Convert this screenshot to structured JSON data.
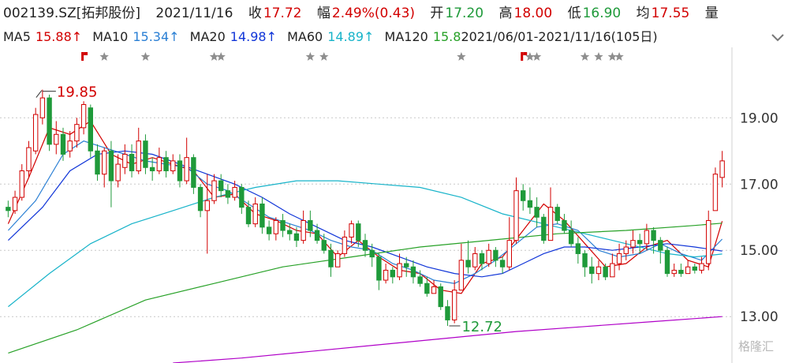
{
  "header": {
    "symbol": "002139.SZ[拓邦股份]",
    "date": "2021/11/16",
    "close_label": "收",
    "close_value": "17.72",
    "change_label": "幅",
    "change_value": "2.49%(0.43)",
    "open_label": "开",
    "open_value": "17.20",
    "high_label": "高",
    "high_value": "18.00",
    "low_label": "低",
    "low_value": "16.90",
    "avg_label": "均",
    "avg_value": "17.55",
    "volume_label": "量"
  },
  "ma_bar": {
    "items": [
      {
        "label": "MA5",
        "value": "15.88↑",
        "color": "#d20000"
      },
      {
        "label": "MA10",
        "value": "15.34↑",
        "color": "#2a7fd4"
      },
      {
        "label": "MA20",
        "value": "14.98↑",
        "color": "#1035d8"
      },
      {
        "label": "MA60",
        "value": "14.89↑",
        "color": "#17b3c9"
      },
      {
        "label": "MA120",
        "value": "15.8",
        "color": "#27a127"
      }
    ],
    "overlap_text": "2021/06/01-2021/11/16(105日)",
    "dropdown_icon": "chevron-down-icon"
  },
  "watermark": "格隆汇",
  "chart_data": {
    "type": "candlestick",
    "y_ticks": [
      19.0,
      17.0,
      15.0,
      13.0
    ],
    "ylim": [
      11.6,
      20.65
    ],
    "annotations": [
      {
        "text": "19.85",
        "kind": "max",
        "index": 5,
        "value": 19.85
      },
      {
        "text": "12.72",
        "kind": "min",
        "index": 64,
        "value": 12.72
      }
    ],
    "colors": {
      "up": "#d20000",
      "down": "#1f9a3a",
      "grid": "#c8c8c8"
    },
    "ohlc": [
      [
        16.3,
        16.2,
        16.5,
        16.0
      ],
      [
        16.2,
        16.6,
        16.8,
        16.1
      ],
      [
        16.6,
        17.4,
        17.6,
        16.5
      ],
      [
        17.4,
        18.1,
        18.3,
        17.2
      ],
      [
        18.0,
        19.1,
        19.3,
        17.9
      ],
      [
        19.0,
        19.6,
        19.85,
        18.8
      ],
      [
        19.6,
        18.2,
        19.7,
        18.0
      ],
      [
        18.2,
        18.5,
        18.9,
        17.9
      ],
      [
        18.5,
        17.9,
        18.7,
        17.7
      ],
      [
        18.0,
        18.3,
        18.6,
        17.8
      ],
      [
        18.3,
        18.8,
        19.0,
        18.1
      ],
      [
        18.7,
        19.4,
        19.5,
        18.5
      ],
      [
        19.3,
        18.0,
        19.4,
        17.8
      ],
      [
        18.0,
        17.3,
        18.2,
        17.1
      ],
      [
        17.3,
        18.0,
        18.1,
        16.9
      ],
      [
        18.0,
        17.1,
        18.3,
        16.3
      ],
      [
        17.1,
        17.6,
        17.9,
        16.9
      ],
      [
        17.5,
        17.9,
        18.2,
        17.3
      ],
      [
        17.9,
        17.4,
        18.2,
        17.2
      ],
      [
        17.4,
        18.3,
        18.7,
        17.3
      ],
      [
        18.3,
        17.5,
        18.5,
        17.3
      ],
      [
        17.5,
        17.4,
        17.8,
        17.1
      ],
      [
        17.4,
        17.8,
        18.1,
        17.3
      ],
      [
        17.8,
        17.4,
        18.0,
        17.2
      ],
      [
        17.4,
        17.7,
        17.9,
        17.3
      ],
      [
        17.7,
        17.1,
        17.9,
        16.9
      ],
      [
        17.1,
        17.8,
        18.4,
        17.0
      ],
      [
        17.8,
        16.9,
        17.9,
        16.7
      ],
      [
        16.9,
        16.2,
        17.0,
        16.0
      ],
      [
        16.2,
        16.5,
        17.3,
        14.9
      ],
      [
        16.5,
        17.1,
        17.3,
        16.4
      ],
      [
        17.1,
        16.8,
        17.3,
        16.6
      ],
      [
        16.8,
        16.6,
        17.0,
        16.4
      ],
      [
        16.6,
        16.9,
        17.1,
        16.5
      ],
      [
        16.9,
        16.3,
        17.0,
        16.1
      ],
      [
        16.3,
        15.8,
        16.5,
        15.7
      ],
      [
        15.8,
        16.4,
        16.6,
        15.7
      ],
      [
        16.4,
        15.7,
        16.6,
        15.5
      ],
      [
        15.7,
        15.5,
        15.9,
        15.3
      ],
      [
        15.5,
        15.9,
        16.0,
        15.3
      ],
      [
        15.9,
        15.6,
        16.1,
        15.4
      ],
      [
        15.6,
        15.5,
        15.8,
        15.3
      ],
      [
        15.5,
        15.3,
        15.7,
        15.1
      ],
      [
        15.3,
        15.9,
        16.2,
        15.2
      ],
      [
        15.9,
        15.6,
        16.2,
        15.4
      ],
      [
        15.6,
        15.3,
        15.8,
        15.2
      ],
      [
        15.3,
        15.0,
        15.5,
        14.9
      ],
      [
        15.0,
        14.5,
        15.2,
        14.2
      ],
      [
        14.5,
        14.9,
        15.0,
        14.5
      ],
      [
        14.9,
        15.4,
        15.6,
        14.8
      ],
      [
        15.4,
        15.8,
        15.9,
        15.2
      ],
      [
        15.8,
        15.3,
        15.9,
        15.1
      ],
      [
        15.3,
        15.0,
        15.5,
        14.8
      ],
      [
        15.0,
        14.8,
        15.2,
        14.5
      ],
      [
        14.8,
        14.1,
        14.9,
        13.8
      ],
      [
        14.1,
        14.4,
        14.6,
        14.0
      ],
      [
        14.4,
        14.2,
        14.5,
        14.0
      ],
      [
        14.2,
        14.6,
        14.9,
        14.1
      ],
      [
        14.6,
        14.5,
        14.8,
        14.2
      ],
      [
        14.5,
        14.2,
        14.7,
        14.0
      ],
      [
        14.2,
        14.0,
        14.4,
        13.9
      ],
      [
        14.0,
        13.7,
        14.2,
        13.6
      ],
      [
        13.7,
        13.9,
        14.1,
        13.7
      ],
      [
        13.9,
        13.3,
        14.0,
        13.2
      ],
      [
        13.3,
        12.9,
        13.5,
        12.72
      ],
      [
        12.9,
        13.8,
        14.1,
        12.8
      ],
      [
        13.8,
        14.7,
        15.2,
        13.8
      ],
      [
        14.7,
        14.5,
        15.3,
        14.3
      ],
      [
        14.5,
        14.9,
        15.1,
        14.4
      ],
      [
        14.9,
        14.6,
        15.0,
        14.4
      ],
      [
        14.6,
        15.0,
        15.2,
        14.5
      ],
      [
        15.0,
        14.7,
        15.1,
        14.5
      ],
      [
        14.7,
        14.5,
        14.8,
        14.3
      ],
      [
        14.5,
        15.3,
        16.0,
        14.4
      ],
      [
        15.3,
        16.8,
        17.2,
        15.2
      ],
      [
        16.8,
        16.5,
        17.0,
        16.2
      ],
      [
        16.5,
        16.3,
        16.9,
        16.1
      ],
      [
        16.3,
        16.0,
        16.6,
        15.7
      ],
      [
        16.0,
        15.3,
        16.1,
        15.2
      ],
      [
        15.3,
        16.3,
        16.9,
        15.3
      ],
      [
        16.3,
        15.9,
        16.4,
        15.8
      ],
      [
        15.9,
        15.6,
        16.1,
        15.5
      ],
      [
        15.6,
        15.2,
        15.9,
        15.1
      ],
      [
        15.2,
        14.9,
        15.4,
        14.6
      ],
      [
        14.9,
        14.5,
        15.0,
        14.2
      ],
      [
        14.5,
        14.3,
        14.8,
        14.0
      ],
      [
        14.3,
        14.5,
        14.7,
        14.1
      ],
      [
        14.5,
        14.2,
        14.6,
        14.1
      ],
      [
        14.2,
        14.6,
        14.9,
        14.2
      ],
      [
        14.6,
        14.9,
        15.2,
        14.4
      ],
      [
        14.9,
        15.1,
        15.3,
        14.7
      ],
      [
        15.1,
        15.3,
        15.6,
        14.9
      ],
      [
        15.3,
        15.2,
        15.5,
        14.9
      ],
      [
        15.2,
        15.6,
        15.8,
        15.0
      ],
      [
        15.6,
        15.3,
        15.7,
        14.9
      ],
      [
        15.3,
        15.0,
        15.4,
        14.6
      ],
      [
        15.0,
        14.3,
        15.1,
        14.2
      ],
      [
        14.3,
        14.4,
        14.6,
        14.2
      ],
      [
        14.4,
        14.3,
        14.6,
        14.2
      ],
      [
        14.3,
        14.5,
        14.7,
        14.3
      ],
      [
        14.5,
        14.4,
        14.6,
        14.3
      ],
      [
        14.4,
        14.6,
        14.8,
        14.3
      ],
      [
        14.6,
        15.9,
        16.2,
        14.4
      ],
      [
        16.2,
        17.3,
        17.5,
        16.8
      ],
      [
        17.2,
        17.7,
        18.0,
        16.9
      ]
    ],
    "series": [
      {
        "key": "ma5",
        "color": "#d20000",
        "points": [
          [
            0,
            15.8
          ],
          [
            3,
            17.2
          ],
          [
            6,
            18.7
          ],
          [
            9,
            18.5
          ],
          [
            12,
            18.9
          ],
          [
            15,
            17.9
          ],
          [
            18,
            17.6
          ],
          [
            21,
            17.8
          ],
          [
            24,
            17.6
          ],
          [
            27,
            17.4
          ],
          [
            30,
            16.6
          ],
          [
            33,
            16.7
          ],
          [
            36,
            16.1
          ],
          [
            39,
            15.9
          ],
          [
            42,
            15.6
          ],
          [
            45,
            15.5
          ],
          [
            48,
            14.8
          ],
          [
            51,
            15.3
          ],
          [
            54,
            14.8
          ],
          [
            57,
            14.4
          ],
          [
            60,
            14.3
          ],
          [
            63,
            13.8
          ],
          [
            66,
            13.7
          ],
          [
            69,
            14.6
          ],
          [
            72,
            14.8
          ],
          [
            75,
            15.6
          ],
          [
            78,
            16.4
          ],
          [
            81,
            15.9
          ],
          [
            84,
            15.2
          ],
          [
            87,
            14.5
          ],
          [
            90,
            14.6
          ],
          [
            93,
            15.1
          ],
          [
            96,
            15.3
          ],
          [
            99,
            14.7
          ],
          [
            102,
            14.5
          ],
          [
            104,
            15.88
          ]
        ]
      },
      {
        "key": "ma10",
        "color": "#2a7fd4",
        "points": [
          [
            0,
            15.6
          ],
          [
            4,
            16.5
          ],
          [
            8,
            17.9
          ],
          [
            11,
            18.3
          ],
          [
            14,
            18.1
          ],
          [
            17,
            17.9
          ],
          [
            20,
            17.7
          ],
          [
            23,
            17.6
          ],
          [
            26,
            17.5
          ],
          [
            29,
            17.0
          ],
          [
            32,
            16.8
          ],
          [
            35,
            16.4
          ],
          [
            38,
            16.0
          ],
          [
            41,
            15.8
          ],
          [
            44,
            15.6
          ],
          [
            47,
            15.3
          ],
          [
            50,
            15.1
          ],
          [
            53,
            15.0
          ],
          [
            56,
            14.6
          ],
          [
            59,
            14.4
          ],
          [
            62,
            14.1
          ],
          [
            65,
            14.0
          ],
          [
            68,
            14.3
          ],
          [
            71,
            14.7
          ],
          [
            74,
            15.2
          ],
          [
            77,
            15.7
          ],
          [
            80,
            15.8
          ],
          [
            83,
            15.6
          ],
          [
            86,
            15.0
          ],
          [
            89,
            14.8
          ],
          [
            92,
            14.9
          ],
          [
            95,
            15.2
          ],
          [
            98,
            14.9
          ],
          [
            101,
            14.7
          ],
          [
            104,
            15.34
          ]
        ]
      },
      {
        "key": "ma20",
        "color": "#1035d8",
        "points": [
          [
            0,
            15.3
          ],
          [
            5,
            16.3
          ],
          [
            9,
            17.4
          ],
          [
            13,
            17.9
          ],
          [
            17,
            18.0
          ],
          [
            21,
            17.9
          ],
          [
            25,
            17.6
          ],
          [
            29,
            17.3
          ],
          [
            33,
            17.0
          ],
          [
            37,
            16.6
          ],
          [
            41,
            16.1
          ],
          [
            45,
            15.7
          ],
          [
            49,
            15.3
          ],
          [
            53,
            15.1
          ],
          [
            57,
            14.8
          ],
          [
            61,
            14.5
          ],
          [
            65,
            14.3
          ],
          [
            69,
            14.2
          ],
          [
            72,
            14.3
          ],
          [
            75,
            14.6
          ],
          [
            78,
            14.9
          ],
          [
            81,
            15.1
          ],
          [
            84,
            15.1
          ],
          [
            88,
            15.0
          ],
          [
            92,
            15.1
          ],
          [
            96,
            15.2
          ],
          [
            100,
            15.1
          ],
          [
            104,
            14.98
          ]
        ]
      },
      {
        "key": "ma60",
        "color": "#17b3c9",
        "points": [
          [
            0,
            13.3
          ],
          [
            6,
            14.3
          ],
          [
            12,
            15.2
          ],
          [
            18,
            15.8
          ],
          [
            24,
            16.2
          ],
          [
            30,
            16.6
          ],
          [
            36,
            16.9
          ],
          [
            42,
            17.1
          ],
          [
            48,
            17.1
          ],
          [
            54,
            17.0
          ],
          [
            60,
            16.9
          ],
          [
            66,
            16.6
          ],
          [
            72,
            16.1
          ],
          [
            78,
            15.8
          ],
          [
            84,
            15.5
          ],
          [
            90,
            15.2
          ],
          [
            96,
            14.9
          ],
          [
            100,
            14.8
          ],
          [
            104,
            14.89
          ]
        ]
      },
      {
        "key": "ma120",
        "color": "#27a127",
        "points": [
          [
            0,
            11.9
          ],
          [
            10,
            12.6
          ],
          [
            20,
            13.5
          ],
          [
            30,
            14.0
          ],
          [
            40,
            14.5
          ],
          [
            50,
            14.8
          ],
          [
            60,
            15.1
          ],
          [
            70,
            15.3
          ],
          [
            80,
            15.5
          ],
          [
            90,
            15.6
          ],
          [
            100,
            15.75
          ],
          [
            104,
            15.82
          ]
        ]
      },
      {
        "key": "ma250",
        "color": "#b000c8",
        "points": [
          [
            24,
            11.6
          ],
          [
            34,
            11.75
          ],
          [
            44,
            11.95
          ],
          [
            54,
            12.15
          ],
          [
            64,
            12.35
          ],
          [
            74,
            12.55
          ],
          [
            84,
            12.7
          ],
          [
            94,
            12.85
          ],
          [
            104,
            13.0
          ]
        ]
      }
    ],
    "events": [
      {
        "index": 11,
        "kind": "red-flag"
      },
      {
        "index": 14,
        "kind": "star"
      },
      {
        "index": 20,
        "kind": "star"
      },
      {
        "index": 30,
        "kind": "star"
      },
      {
        "index": 31,
        "kind": "star"
      },
      {
        "index": 44,
        "kind": "star"
      },
      {
        "index": 46,
        "kind": "star"
      },
      {
        "index": 66,
        "kind": "star"
      },
      {
        "index": 75,
        "kind": "red-flag"
      },
      {
        "index": 76,
        "kind": "star"
      },
      {
        "index": 77,
        "kind": "star"
      },
      {
        "index": 84,
        "kind": "star"
      },
      {
        "index": 86,
        "kind": "star"
      },
      {
        "index": 88,
        "kind": "star"
      },
      {
        "index": 89,
        "kind": "star"
      }
    ]
  }
}
